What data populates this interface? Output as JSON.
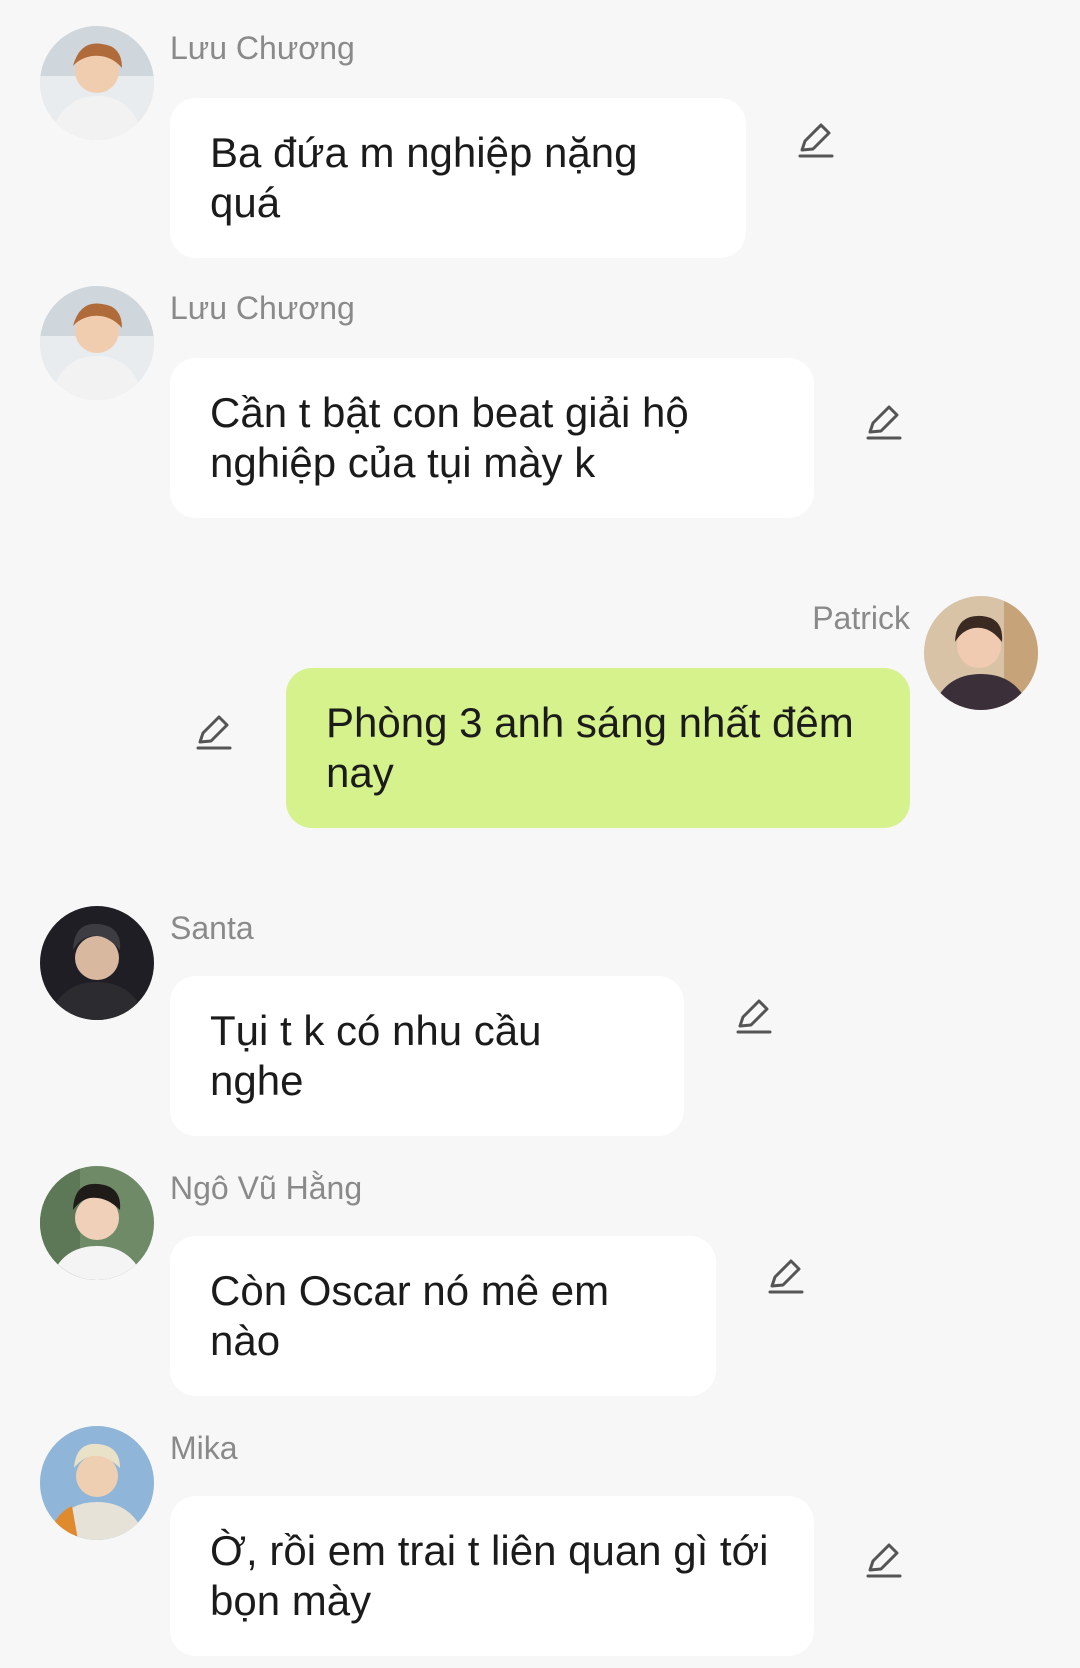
{
  "messages": [
    {
      "sender": "Lưu Chương",
      "text": "Ba đứa m nghiệp nặng quá",
      "icon": "edit-icon"
    },
    {
      "sender": "Lưu Chương",
      "text": "Cần t bật con beat giải hộ nghiệp của tụi mày k",
      "icon": "edit-icon"
    },
    {
      "sender": "Patrick",
      "text": "Phòng 3 anh sáng nhất đêm nay",
      "icon": "edit-icon"
    },
    {
      "sender": "Santa",
      "text": "Tụi t k có nhu cầu nghe",
      "icon": "edit-icon"
    },
    {
      "sender": "Ngô Vũ Hằng",
      "text": "Còn Oscar nó mê em nào",
      "icon": "edit-icon"
    },
    {
      "sender": "Mika",
      "text": "Ờ, rồi em trai t liên quan gì tới bọn mày",
      "icon": "edit-icon"
    }
  ],
  "colors": {
    "background": "#f7f7f7",
    "bubble_incoming": "#ffffff",
    "bubble_outgoing": "#d6f28c",
    "sender_name": "#8a8a8a",
    "message_text": "#1b1b1b"
  }
}
